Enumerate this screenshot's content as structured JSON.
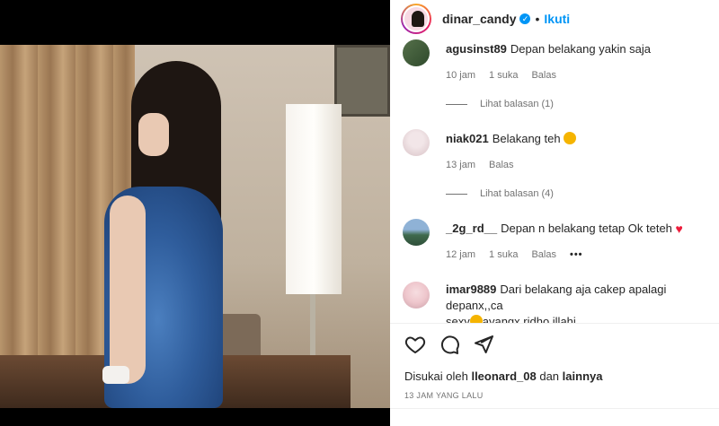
{
  "post": {
    "username": "dinar_candy",
    "separator": "•",
    "follow_label": "Ikuti",
    "likes_prefix": "Disukai oleh",
    "likes_user": "lleonard_08",
    "likes_and": "dan",
    "likes_others": "lainnya",
    "timestamp": "13 JAM YANG LALU"
  },
  "comments": [
    {
      "user": "agusinst89",
      "text": "Depan belakang yakin saja",
      "time": "10 jam",
      "likes": "1 suka",
      "reply": "Balas",
      "view_replies": "Lihat balasan (1)"
    },
    {
      "user": "niak021",
      "text": "Belakang teh",
      "time": "13 jam",
      "reply": "Balas",
      "view_replies": "Lihat balasan (4)"
    },
    {
      "user": "_2g_rd__",
      "text": "Depan n belakang tetap Ok teteh",
      "time": "12 jam",
      "likes": "1 suka",
      "reply": "Balas",
      "more": "•••"
    },
    {
      "user": "imar9889",
      "text": "Dari belakang aja cakep apalagi depanx,,ca",
      "text2": "sexy",
      "text3": "ayangx ridho illahi"
    }
  ],
  "icons": {
    "verified": "verified-badge-icon",
    "like": "heart-icon",
    "comment": "comment-bubble-icon",
    "share": "send-paper-plane-icon",
    "comment_emoji": "heart-eyes-emoji-icon",
    "red_heart": "red-heart-emoji-icon"
  },
  "colors": {
    "link_blue": "#0095f6",
    "secondary_text": "#737373",
    "primary_text": "#262626"
  }
}
